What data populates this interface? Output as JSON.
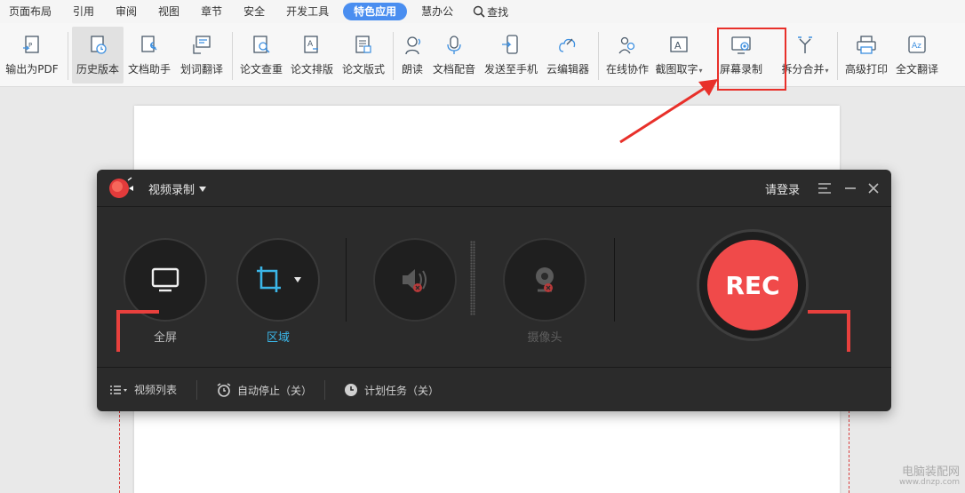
{
  "menu": {
    "items": [
      "页面布局",
      "引用",
      "审阅",
      "视图",
      "章节",
      "安全",
      "开发工具"
    ],
    "active": "特色应用",
    "after": [
      "慧办公"
    ],
    "search": "查找"
  },
  "toolbar": {
    "tools": [
      {
        "label": "输出为PDF",
        "icon": "pdf-export-icon"
      },
      {
        "label": "历史版本",
        "icon": "history-icon",
        "pressed": true
      },
      {
        "label": "文档助手",
        "icon": "doc-assistant-icon"
      },
      {
        "label": "划词翻译",
        "icon": "translate-word-icon"
      },
      {
        "label": "论文查重",
        "icon": "paper-check-icon"
      },
      {
        "label": "论文排版",
        "icon": "paper-layout-icon"
      },
      {
        "label": "论文版式",
        "icon": "paper-format-icon"
      },
      {
        "label": "朗读",
        "icon": "read-aloud-icon"
      },
      {
        "label": "文档配音",
        "icon": "voice-over-icon"
      },
      {
        "label": "发送至手机",
        "icon": "send-phone-icon"
      },
      {
        "label": "云编辑器",
        "icon": "cloud-editor-icon"
      },
      {
        "label": "在线协作",
        "icon": "collaborate-icon"
      },
      {
        "label": "截图取字",
        "icon": "ocr-icon"
      },
      {
        "label": "屏幕录制",
        "icon": "screen-record-icon"
      },
      {
        "label": "拆分合并",
        "icon": "split-merge-icon"
      },
      {
        "label": "高级打印",
        "icon": "print-icon"
      },
      {
        "label": "全文翻译",
        "icon": "full-translate-icon"
      }
    ]
  },
  "recorder": {
    "mode": "视频录制",
    "login": "请登录",
    "fullscreen_label": "全屏",
    "region_label": "区域",
    "camera_label": "摄像头",
    "rec_label": "REC",
    "bottom": {
      "video_list": "视频列表",
      "auto_stop": "自动停止（关）",
      "schedule": "计划任务（关）"
    },
    "colors": {
      "accent": "#3bb6e8",
      "rec": "#f04a4a"
    }
  },
  "watermark": {
    "line1": "电脑装配网",
    "line2": "www.dnzp.com"
  }
}
